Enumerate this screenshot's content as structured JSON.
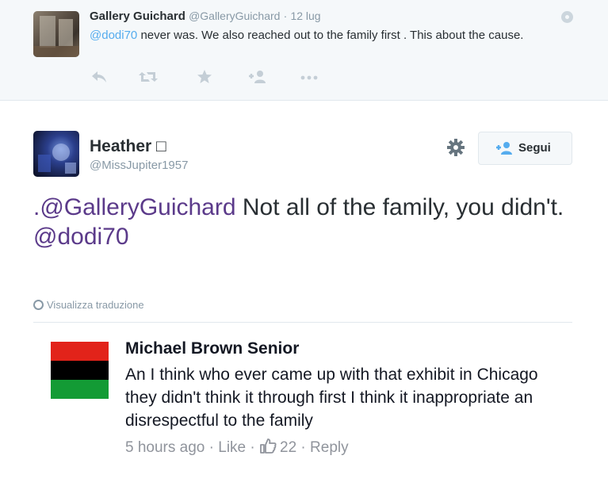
{
  "reply": {
    "name": "Gallery Guichard",
    "handle": "@GalleryGuichard",
    "separator": "·",
    "date": "12 lug",
    "mention": "@dodi70",
    "text": " never was. We also reached out to the family first . This about the cause.",
    "actions": {
      "reply_icon": "reply-icon",
      "retweet_icon": "retweet-icon",
      "favorite_icon": "star-icon",
      "follow_icon": "follow-icon",
      "more_icon": "more-icon"
    }
  },
  "tweet": {
    "name": "Heather □",
    "handle": "@MissJupiter1957",
    "follow_label": "Segui",
    "mention1": ".@GalleryGuichard",
    "text": " Not all of the family, you didn't.",
    "mention2": "@dodi70",
    "translate_label": "Visualizza traduzione"
  },
  "comment": {
    "name": "Michael Brown Senior",
    "text": "An I think who ever came up with that exhibit in Chicago they didn't think it through first I think it inappropriate an disrespectful to the family",
    "time": "5 hours ago",
    "sep1": " · ",
    "like_label": "Like",
    "sep2": " · ",
    "like_count": "22",
    "sep3": " · ",
    "reply_label": "Reply"
  },
  "colors": {
    "mention_purple": "#5b3a8a",
    "flag_red": "#e2231a",
    "flag_black": "#000000",
    "flag_green": "#139b35"
  }
}
